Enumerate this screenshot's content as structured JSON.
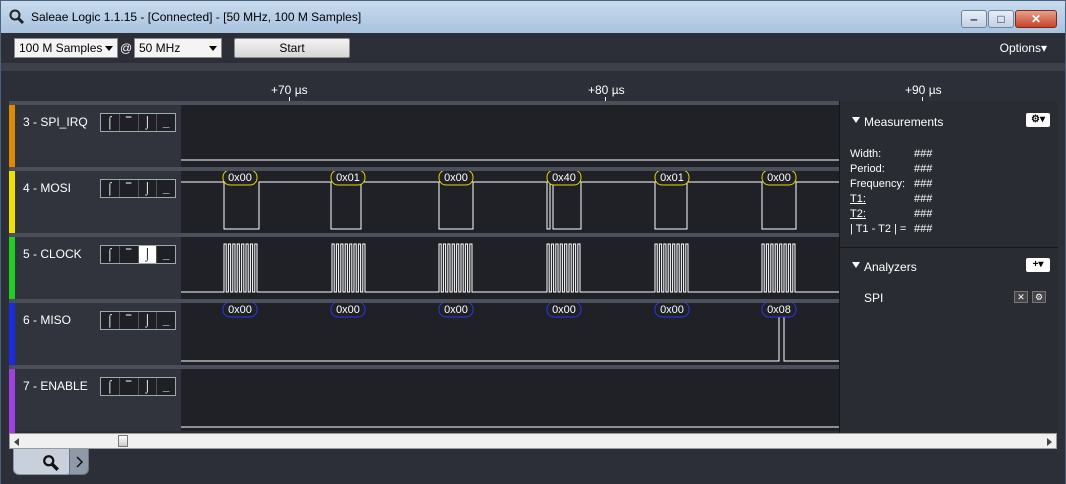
{
  "window": {
    "title": "Saleae Logic 1.1.15 - [Connected] - [50 MHz, 100 M Samples]",
    "minimize_glyph": "‒",
    "maximize_glyph": "□",
    "close_glyph": "✕"
  },
  "toolbar": {
    "samples": "100 M Samples",
    "at": "@",
    "rate": "50 MHz",
    "start_label": "Start",
    "options_label": "Options▾"
  },
  "ruler": {
    "ticks": [
      "+70 µs",
      "+80 µs",
      "+90 µs"
    ]
  },
  "trigger_glyphs": [
    "⌠",
    "‾",
    "⌡",
    "_"
  ],
  "channels": [
    {
      "label": "3 - SPI_IRQ",
      "color": "#e08a00"
    },
    {
      "label": "4 - MOSI",
      "color": "#f0e000"
    },
    {
      "label": "5 - CLOCK",
      "color": "#20d020"
    },
    {
      "label": "6 - MISO",
      "color": "#1a2ae0"
    },
    {
      "label": "7 - ENABLE",
      "color": "#a040e0"
    }
  ],
  "mosi_bytes": [
    "0x00",
    "0x01",
    "0x00",
    "0x40",
    "0x01",
    "0x00"
  ],
  "miso_bytes": [
    "0x00",
    "0x00",
    "0x00",
    "0x00",
    "0x00",
    "0x08"
  ],
  "measurements": {
    "title": "Measurements",
    "rows": [
      {
        "key": "Width:",
        "value": "###"
      },
      {
        "key": "Period:",
        "value": "###"
      },
      {
        "key": "Frequency:",
        "value": "###"
      },
      {
        "key": "T1:",
        "value": "###"
      },
      {
        "key": "T2:",
        "value": "###"
      },
      {
        "key": "| T1 - T2 | =",
        "value": "###"
      }
    ]
  },
  "analyzers": {
    "title": "Analyzers",
    "items": [
      {
        "name": "SPI"
      }
    ]
  }
}
